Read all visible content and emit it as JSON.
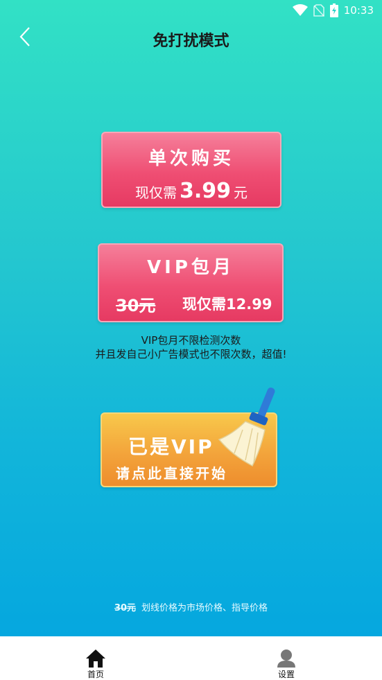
{
  "status_bar": {
    "time": "10:33"
  },
  "header": {
    "title": "免打扰模式"
  },
  "single_purchase": {
    "title": "单次购买",
    "price_prefix": "现仅需",
    "price_value": "3.99",
    "price_unit": "元"
  },
  "vip_monthly": {
    "title": "VIP包月",
    "original_price": "30元",
    "current_price": "现仅需12.99"
  },
  "vip_description": {
    "line1": "VIP包月不限检测次数",
    "line2": "并且发自己小广告模式也不限次数，超值!"
  },
  "start_button": {
    "title": "已是VIP",
    "subtitle": "请点此直接开始"
  },
  "price_note": {
    "strike_text": "30元",
    "text": "划线价格为市场价格、指导价格"
  },
  "bottom_nav": {
    "home_label": "首页",
    "settings_label": "设置"
  },
  "colors": {
    "gradient_top": "#32e1c5",
    "gradient_bottom": "#05a7df",
    "pink_card": "#ef4e73",
    "orange_card": "#f3a43b"
  }
}
